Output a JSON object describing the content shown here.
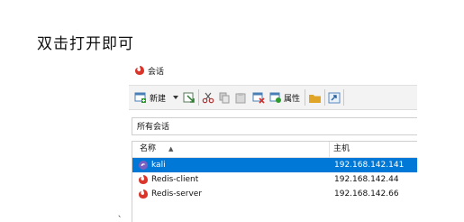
{
  "heading": "双击打开即可",
  "window": {
    "title": "会话"
  },
  "toolbar": {
    "new_label": "新建",
    "properties_label": "属性"
  },
  "breadcrumb": "所有会话",
  "columns": {
    "name": "名称",
    "host": "主机"
  },
  "sessions": [
    {
      "name": "kali",
      "host": "192.168.142.141",
      "selected": true
    },
    {
      "name": "Redis-client",
      "host": "192.168.142.44",
      "selected": false
    },
    {
      "name": "Redis-server",
      "host": "192.168.142.66",
      "selected": false
    }
  ],
  "colors": {
    "selection": "#0078d7",
    "logo_red": "#d9352b"
  },
  "stray_mark": "、"
}
